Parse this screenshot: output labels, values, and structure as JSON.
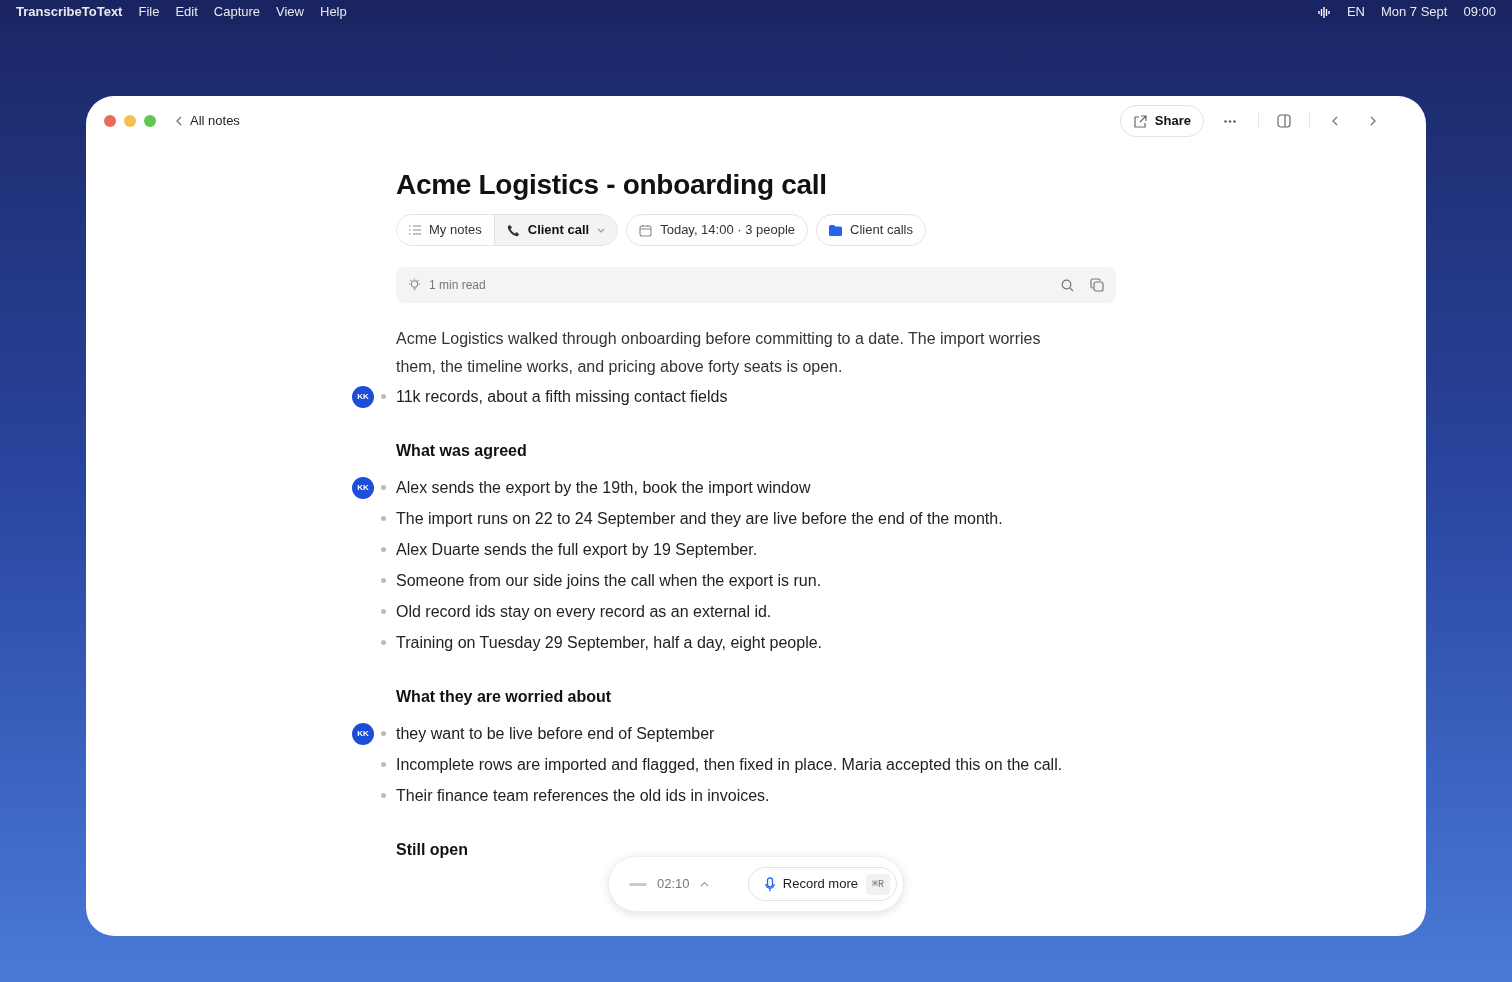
{
  "menu_bar": {
    "app_name": "TranscribeToText",
    "menus": [
      "File",
      "Edit",
      "Capture",
      "View",
      "Help"
    ],
    "language": "EN",
    "date": "Mon 7 Sept",
    "time": "09:00"
  },
  "toolbar": {
    "back_label": "All notes",
    "share_label": "Share"
  },
  "note": {
    "title": "Acme Logistics - onboarding call",
    "template_tabs": [
      {
        "label": "My notes",
        "kind": "list",
        "selected": false
      },
      {
        "label": "Client call",
        "kind": "phone",
        "selected": true
      }
    ],
    "meeting_info": "Today, 14:00 · 3 people",
    "folder": "Client calls",
    "summary_bar": {
      "label": "1 min read"
    },
    "blocks": [
      {
        "kind": "paragraph",
        "text": "Acme Logistics walked through onboarding before committing to a date. The import worries them, the timeline works, and pricing above forty seats is open."
      },
      {
        "kind": "bullet",
        "text": "11k records, about a fifth missing contact fields",
        "avatar": "KK"
      },
      {
        "kind": "heading",
        "text": "What was agreed"
      },
      {
        "kind": "bullet",
        "text": "Alex sends the export by the 19th, book the import window",
        "avatar": "KK"
      },
      {
        "kind": "bullet",
        "text": "The import runs on 22 to 24 September and they are live before the end of the month."
      },
      {
        "kind": "bullet",
        "text": "Alex Duarte sends the full export by 19 September."
      },
      {
        "kind": "bullet",
        "text": "Someone from our side joins the call when the export is run."
      },
      {
        "kind": "bullet",
        "text": "Old record ids stay on every record as an external id."
      },
      {
        "kind": "bullet",
        "text": "Training on Tuesday 29 September, half a day, eight people."
      },
      {
        "kind": "heading",
        "text": "What they are worried about"
      },
      {
        "kind": "bullet",
        "text": "they want to be live before end of September",
        "avatar": "KK"
      },
      {
        "kind": "bullet",
        "text": "Incomplete rows are imported and flagged, then fixed in place. Maria accepted this on the call."
      },
      {
        "kind": "bullet",
        "text": "Their finance team references the old ids in invoices."
      },
      {
        "kind": "heading",
        "text": "Still open"
      }
    ]
  },
  "recorder": {
    "elapsed": "02:10",
    "record_label": "Record more",
    "shortcut": "⌘R"
  }
}
